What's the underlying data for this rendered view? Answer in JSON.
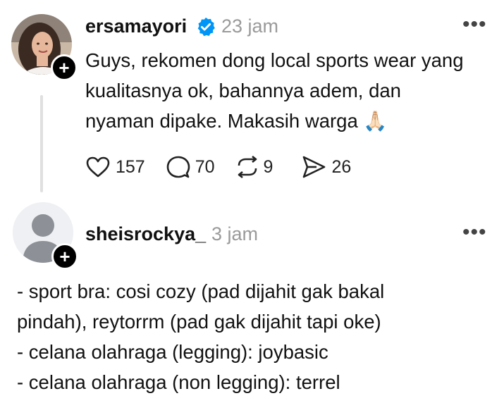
{
  "post": {
    "username": "ersamayori",
    "timestamp": "23 jam",
    "text_lines": [
      "Guys, rekomen dong local sports wear yang",
      "kualitasnya ok, bahannya adem, dan",
      "nyaman dipake. Makasih warga"
    ],
    "emoji": "🙏🏻",
    "likes": "157",
    "comments": "70",
    "reposts": "9",
    "shares": "26",
    "verified_color": "#0095f6"
  },
  "reply": {
    "username": "sheisrockya_",
    "timestamp": "3 jam",
    "text_lines": [
      "- sport bra: cosi cozy (pad dijahit gak bakal",
      "pindah), reytorrm (pad gak dijahit tapi oke)",
      "- celana olahraga (legging): joybasic",
      "- celana olahraga (non legging): terrel"
    ]
  },
  "icons": {
    "follow": "plus-icon",
    "verified": "verified-badge-icon",
    "more": "more-options-icon",
    "like": "heart-icon",
    "comment": "comment-bubble-icon",
    "repost": "repost-icon",
    "share": "share-send-icon"
  }
}
